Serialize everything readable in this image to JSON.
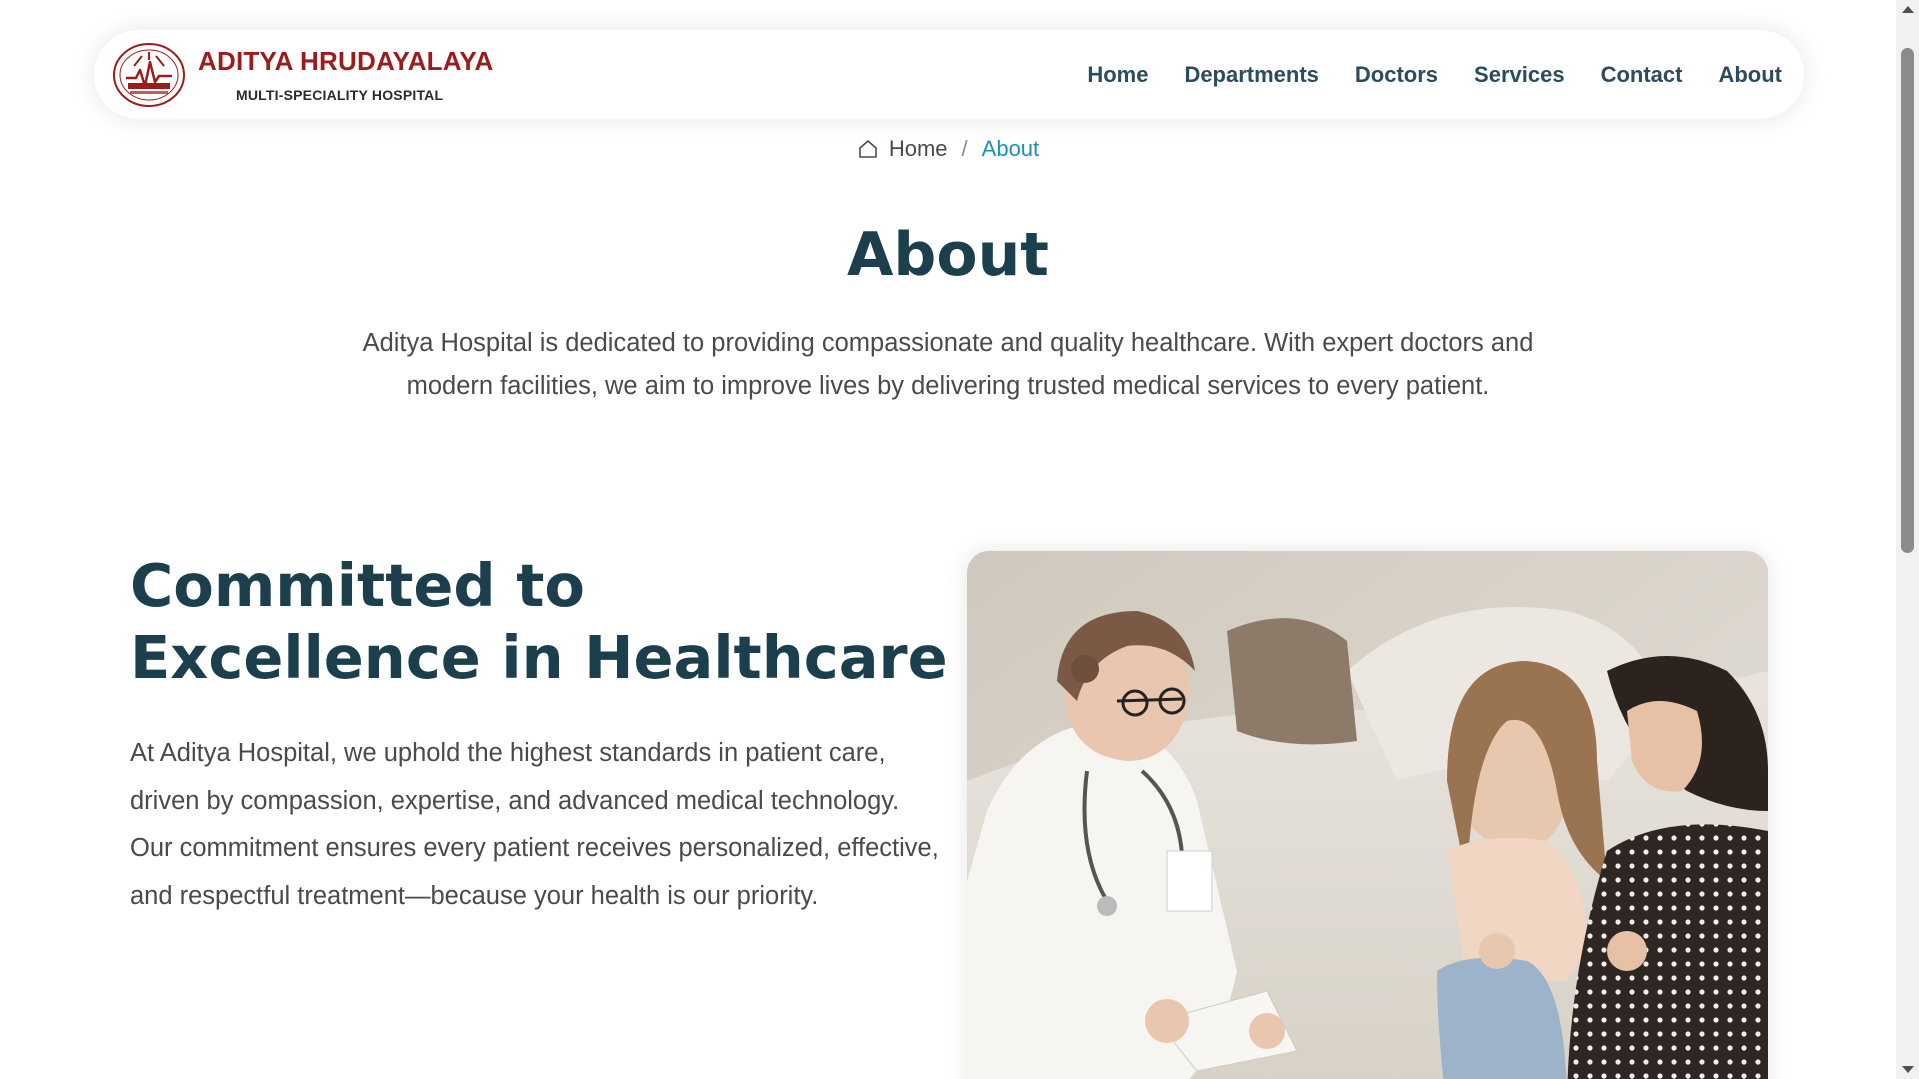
{
  "brand": {
    "name": "ADITYA HRUDAYALAYA",
    "tagline": "MULTI-SPECIALITY HOSPITAL",
    "logo_icon": "hospital-seal-logo",
    "primary_color": "#9b1c1c"
  },
  "nav": {
    "items": [
      {
        "label": "Home"
      },
      {
        "label": "Departments"
      },
      {
        "label": "Doctors"
      },
      {
        "label": "Services"
      },
      {
        "label": "Contact"
      },
      {
        "label": "About"
      }
    ],
    "color": "#2c4b5c"
  },
  "breadcrumb": {
    "home_icon": "home-icon",
    "home_label": "Home",
    "separator": "/",
    "current_label": "About",
    "current_color": "#1a8fb5"
  },
  "page": {
    "title": "About",
    "intro": "Aditya Hospital is dedicated to providing compassionate and quality healthcare. With expert doctors and modern facilities, we aim to improve lives by delivering trusted medical services to every patient.",
    "heading_color": "#1b3f4c"
  },
  "excellence": {
    "title": "Committed to Excellence in Healthcare",
    "body": "At Aditya Hospital, we uphold the highest standards in patient care, driven by compassion, expertise, and advanced medical technology. Our commitment ensures every patient receives personalized, effective, and respectful treatment—because your health is our priority.",
    "image_description_icon": "doctor-with-patient-photo"
  }
}
